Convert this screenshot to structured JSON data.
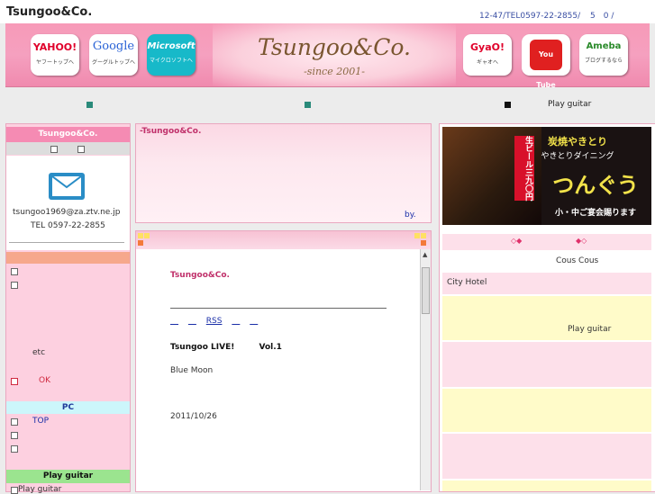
{
  "header": {
    "site_name": "Tsungoo&Co.",
    "contact": "12-47/TEL0597-22-2855/",
    "contact_extra": "5　0 /"
  },
  "banner": {
    "title": "Tsungoo&Co.",
    "since": "-since 2001-",
    "buttons_left": [
      {
        "logo": "YAHOO!",
        "caption": "ヤフートップへ",
        "color": "#e0002a"
      },
      {
        "logo": "Google",
        "caption": "グーグルトップへ",
        "color": "#2a63d6"
      },
      {
        "logo": "Microsoft",
        "caption": "マイクロソフトへ",
        "color": "#ffffff"
      }
    ],
    "buttons_right": [
      {
        "logo": "GyaO!",
        "caption": "ギャオへ",
        "color": "#e0002a"
      },
      {
        "logo": "You Tube",
        "caption": "",
        "color": "#ffffff"
      },
      {
        "logo": "Ameba",
        "caption": "ブログするなら",
        "color": "#2a8a2a"
      }
    ],
    "colors": {
      "pink": "#f5a0bf",
      "title": "#7a5630"
    }
  },
  "nav": {
    "play_guitar": "Play guitar"
  },
  "left": {
    "header": "Tsungoo&Co.",
    "email": "tsungoo1969@za.ztv.ne.jp",
    "tel": "TEL 0597-22-2855",
    "etc": "etc",
    "ok": "OK",
    "pc": "PC",
    "top": "TOP",
    "play_guitar_header": "Play guitar",
    "play_guitar_item": "Play guitar"
  },
  "mid": {
    "top_title": "-Tsungoo&Co.",
    "by": "by.",
    "body_title": "Tsungoo&Co.",
    "rss": "RSS",
    "live": "Tsungoo LIVE!",
    "vol": "Vol.1",
    "song": "Blue Moon",
    "date": "2011/10/26"
  },
  "right": {
    "ad_text": {
      "beer": "生ビール三九〇円",
      "main": "つんぐう",
      "sub": "小・中ご宴会賜ります",
      "top": "炭焼やきとり",
      "mid": "やきとりダイニング"
    },
    "diamonds_1": "◇◆",
    "diamonds_2": "◆◇",
    "cous": "Cous Cous",
    "city_hotel": "City Hotel",
    "play_guitar": "Play guitar"
  }
}
